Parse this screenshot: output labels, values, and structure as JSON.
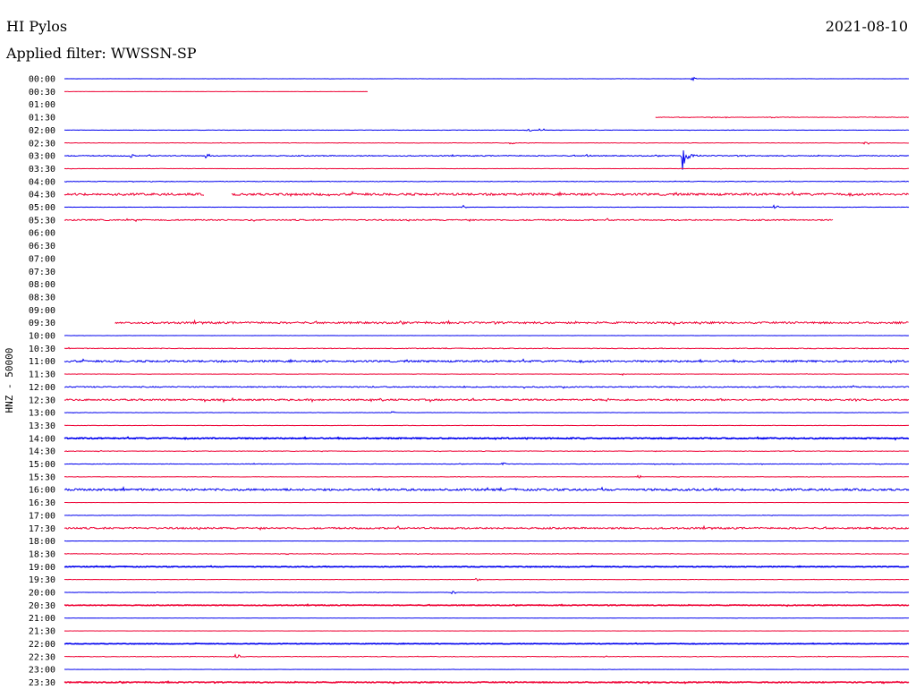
{
  "header": {
    "station": "HI Pylos",
    "date": "2021-08-10",
    "filter": "Applied filter: WWSSN-SP"
  },
  "colors": {
    "odd": "#0000ee",
    "even": "#ee0033",
    "text": "#000000"
  },
  "chart_data": {
    "type": "line",
    "title": "HI Pylos",
    "ylabel": "HNZ - 50000",
    "x_range_minutes": [
      0,
      30
    ],
    "traces": [
      {
        "label": "00:00",
        "color": "blue",
        "start": 0.0,
        "end": 1.0,
        "noise": 0.1,
        "events": [
          {
            "pos": 0.745,
            "amp": 1.5
          }
        ]
      },
      {
        "label": "00:30",
        "color": "red",
        "start": 0.0,
        "end": 0.36,
        "noise": 0.1,
        "events": []
      },
      {
        "label": "01:00",
        "color": "blue",
        "start": null,
        "end": null,
        "noise": 0,
        "events": []
      },
      {
        "label": "01:30",
        "color": "red",
        "start": 0.7,
        "end": 1.0,
        "noise": 0.3,
        "events": []
      },
      {
        "label": "02:00",
        "color": "blue",
        "start": 0.0,
        "end": 1.0,
        "noise": 0.2,
        "events": [
          {
            "pos": 0.55,
            "amp": 1.5
          },
          {
            "pos": 0.565,
            "amp": 1.5
          }
        ]
      },
      {
        "label": "02:30",
        "color": "red",
        "start": 0.0,
        "end": 1.0,
        "noise": 0.2,
        "events": [
          {
            "pos": 0.53,
            "amp": 1.5
          },
          {
            "pos": 0.95,
            "amp": 1.5
          }
        ]
      },
      {
        "label": "03:00",
        "color": "blue",
        "start": 0.0,
        "end": 1.0,
        "noise": 0.5,
        "events": [
          {
            "pos": 0.08,
            "amp": 2
          },
          {
            "pos": 0.17,
            "amp": 2
          },
          {
            "pos": 0.62,
            "amp": 1.5
          },
          {
            "pos": 0.73,
            "amp": 22
          }
        ]
      },
      {
        "label": "03:30",
        "color": "red",
        "start": 0.0,
        "end": 1.0,
        "noise": 0.2,
        "events": []
      },
      {
        "label": "04:00",
        "color": "blue",
        "start": 0.0,
        "end": 1.0,
        "noise": 0.3,
        "events": []
      },
      {
        "label": "04:30",
        "color": "red",
        "start": 0.0,
        "end": 1.0,
        "noise": 1.2,
        "events": [],
        "gap": [
          0.166,
          0.198
        ]
      },
      {
        "label": "05:00",
        "color": "blue",
        "start": 0.0,
        "end": 1.0,
        "noise": 0.2,
        "events": [
          {
            "pos": 0.473,
            "amp": 2
          },
          {
            "pos": 0.843,
            "amp": 2
          }
        ]
      },
      {
        "label": "05:30",
        "color": "red",
        "start": 0.0,
        "end": 0.91,
        "noise": 0.7,
        "events": []
      },
      {
        "label": "06:00",
        "color": "blue",
        "start": null,
        "end": null,
        "noise": 0,
        "events": []
      },
      {
        "label": "06:30",
        "color": "red",
        "start": null,
        "end": null,
        "noise": 0,
        "events": []
      },
      {
        "label": "07:00",
        "color": "blue",
        "start": null,
        "end": null,
        "noise": 0,
        "events": []
      },
      {
        "label": "07:30",
        "color": "red",
        "start": null,
        "end": null,
        "noise": 0,
        "events": []
      },
      {
        "label": "08:00",
        "color": "blue",
        "start": null,
        "end": null,
        "noise": 0,
        "events": []
      },
      {
        "label": "08:30",
        "color": "red",
        "start": null,
        "end": null,
        "noise": 0,
        "events": []
      },
      {
        "label": "09:00",
        "color": "blue",
        "start": null,
        "end": null,
        "noise": 0,
        "events": []
      },
      {
        "label": "09:30",
        "color": "red",
        "start": 0.06,
        "end": 1.0,
        "noise": 1.0,
        "events": []
      },
      {
        "label": "10:00",
        "color": "blue",
        "start": 0.0,
        "end": 1.0,
        "noise": 0.1,
        "events": []
      },
      {
        "label": "10:30",
        "color": "red",
        "start": 0.0,
        "end": 1.0,
        "noise": 0.4,
        "events": []
      },
      {
        "label": "11:00",
        "color": "blue",
        "start": 0.0,
        "end": 1.0,
        "noise": 1.0,
        "events": []
      },
      {
        "label": "11:30",
        "color": "red",
        "start": 0.0,
        "end": 1.0,
        "noise": 0.2,
        "events": [
          {
            "pos": 0.66,
            "amp": 1.5
          }
        ]
      },
      {
        "label": "12:00",
        "color": "blue",
        "start": 0.0,
        "end": 1.0,
        "noise": 0.6,
        "events": []
      },
      {
        "label": "12:30",
        "color": "red",
        "start": 0.0,
        "end": 1.0,
        "noise": 0.9,
        "events": []
      },
      {
        "label": "13:00",
        "color": "blue",
        "start": 0.0,
        "end": 1.0,
        "noise": 0.2,
        "events": [
          {
            "pos": 0.39,
            "amp": 1.5
          }
        ]
      },
      {
        "label": "13:30",
        "color": "red",
        "start": 0.0,
        "end": 1.0,
        "noise": 0.2,
        "events": []
      },
      {
        "label": "14:00",
        "color": "blue",
        "start": 0.0,
        "end": 1.0,
        "noise": 0.6,
        "events": [],
        "thick": true
      },
      {
        "label": "14:30",
        "color": "red",
        "start": 0.0,
        "end": 1.0,
        "noise": 0.3,
        "events": []
      },
      {
        "label": "15:00",
        "color": "blue",
        "start": 0.0,
        "end": 1.0,
        "noise": 0.3,
        "events": [
          {
            "pos": 0.52,
            "amp": 1.5
          }
        ]
      },
      {
        "label": "15:30",
        "color": "red",
        "start": 0.0,
        "end": 1.0,
        "noise": 0.2,
        "events": [
          {
            "pos": 0.68,
            "amp": 1.5
          }
        ]
      },
      {
        "label": "16:00",
        "color": "blue",
        "start": 0.0,
        "end": 1.0,
        "noise": 1.1,
        "events": []
      },
      {
        "label": "16:30",
        "color": "red",
        "start": 0.0,
        "end": 1.0,
        "noise": 0.1,
        "events": []
      },
      {
        "label": "17:00",
        "color": "blue",
        "start": 0.0,
        "end": 1.0,
        "noise": 0.2,
        "events": []
      },
      {
        "label": "17:30",
        "color": "red",
        "start": 0.0,
        "end": 1.0,
        "noise": 0.9,
        "events": []
      },
      {
        "label": "18:00",
        "color": "blue",
        "start": 0.0,
        "end": 1.0,
        "noise": 0.1,
        "events": []
      },
      {
        "label": "18:30",
        "color": "red",
        "start": 0.0,
        "end": 1.0,
        "noise": 0.3,
        "events": []
      },
      {
        "label": "19:00",
        "color": "blue",
        "start": 0.0,
        "end": 1.0,
        "noise": 0.4,
        "events": [],
        "thick": true
      },
      {
        "label": "19:30",
        "color": "red",
        "start": 0.0,
        "end": 1.0,
        "noise": 0.2,
        "events": [
          {
            "pos": 0.49,
            "amp": 1.5
          }
        ]
      },
      {
        "label": "20:00",
        "color": "blue",
        "start": 0.0,
        "end": 1.0,
        "noise": 0.2,
        "events": [
          {
            "pos": 0.46,
            "amp": 1.5
          }
        ]
      },
      {
        "label": "20:30",
        "color": "red",
        "start": 0.0,
        "end": 1.0,
        "noise": 0.4,
        "events": [],
        "thick": true
      },
      {
        "label": "21:00",
        "color": "blue",
        "start": 0.0,
        "end": 1.0,
        "noise": 0.1,
        "events": []
      },
      {
        "label": "21:30",
        "color": "red",
        "start": 0.0,
        "end": 1.0,
        "noise": 0.1,
        "events": []
      },
      {
        "label": "22:00",
        "color": "blue",
        "start": 0.0,
        "end": 1.0,
        "noise": 0.3,
        "events": [],
        "thick": true
      },
      {
        "label": "22:30",
        "color": "red",
        "start": 0.0,
        "end": 1.0,
        "noise": 0.3,
        "events": [
          {
            "pos": 0.205,
            "amp": 2
          }
        ]
      },
      {
        "label": "23:00",
        "color": "blue",
        "start": 0.0,
        "end": 1.0,
        "noise": 0.1,
        "events": []
      },
      {
        "label": "23:30",
        "color": "red",
        "start": 0.0,
        "end": 1.0,
        "noise": 0.5,
        "events": [],
        "thick": true
      }
    ]
  }
}
